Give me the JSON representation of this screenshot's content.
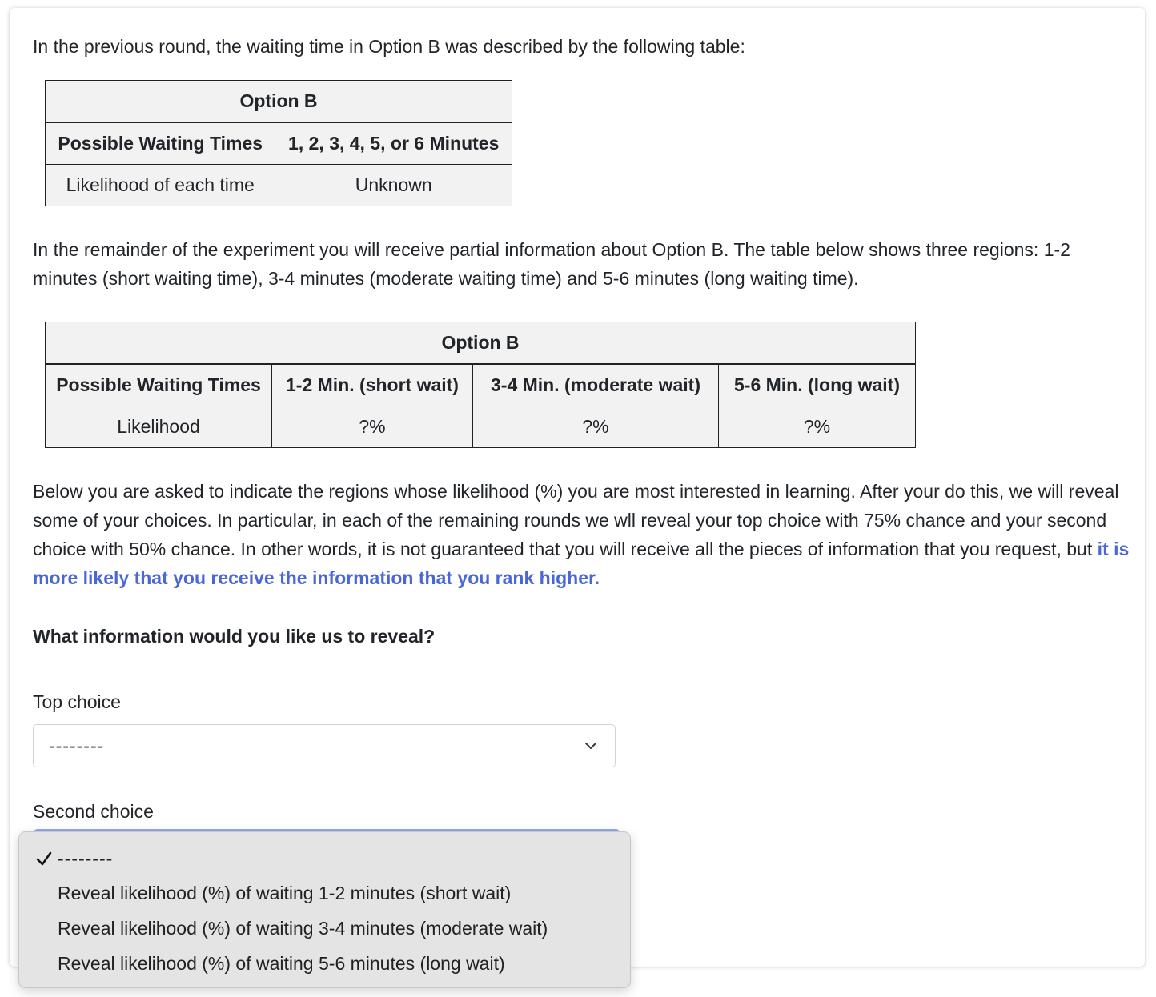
{
  "intro_text": "In the previous round, the waiting time in Option B was described by the following table:",
  "table1": {
    "title": "Option B",
    "header": [
      "Possible Waiting Times",
      "1, 2, 3, 4, 5, or 6 Minutes"
    ],
    "row": [
      "Likelihood of each time",
      "Unknown"
    ]
  },
  "partial_text": "In the remainder of the experiment you will receive partial information about Option B. The table below shows three regions: 1-2 minutes (short waiting time), 3-4 minutes (moderate waiting time) and 5-6 minutes (long waiting time).",
  "table2": {
    "title": "Option B",
    "header": [
      "Possible Waiting Times",
      "1-2 Min. (short wait)",
      "3-4 Min. (moderate wait)",
      "5-6 Min. (long wait)"
    ],
    "row": [
      "Likelihood",
      "?%",
      "?%",
      "?%"
    ]
  },
  "instructions": {
    "text": "Below you are asked to indicate the regions whose likelihood (%) you are most interested in learning. After your do this, we will reveal some of your choices. In particular, in each of the remaining rounds we wll reveal your top choice with 75% chance and your second choice with 50% chance. In other words, it is not guaranteed that you will receive all the pieces of information that you request, but ",
    "highlight": "it is more likely that you receive the information that you rank higher."
  },
  "question": "What information would you like us to reveal?",
  "top_choice": {
    "label": "Top choice",
    "value": "--------"
  },
  "second_choice": {
    "label": "Second choice",
    "options": [
      "--------",
      "Reveal likelihood (%) of waiting 1-2 minutes (short wait)",
      "Reveal likelihood (%) of waiting 3-4 minutes (moderate wait)",
      "Reveal likelihood (%) of waiting 5-6 minutes (long wait)"
    ],
    "selected_index": 0
  },
  "colors": {
    "highlight": "#4a67d6",
    "table_bg": "#f2f2f2",
    "dropdown_bg": "#e4e4e4",
    "focus_border": "#8fa8ef"
  },
  "icons": [
    "chevron-down-icon",
    "checkmark-icon"
  ]
}
